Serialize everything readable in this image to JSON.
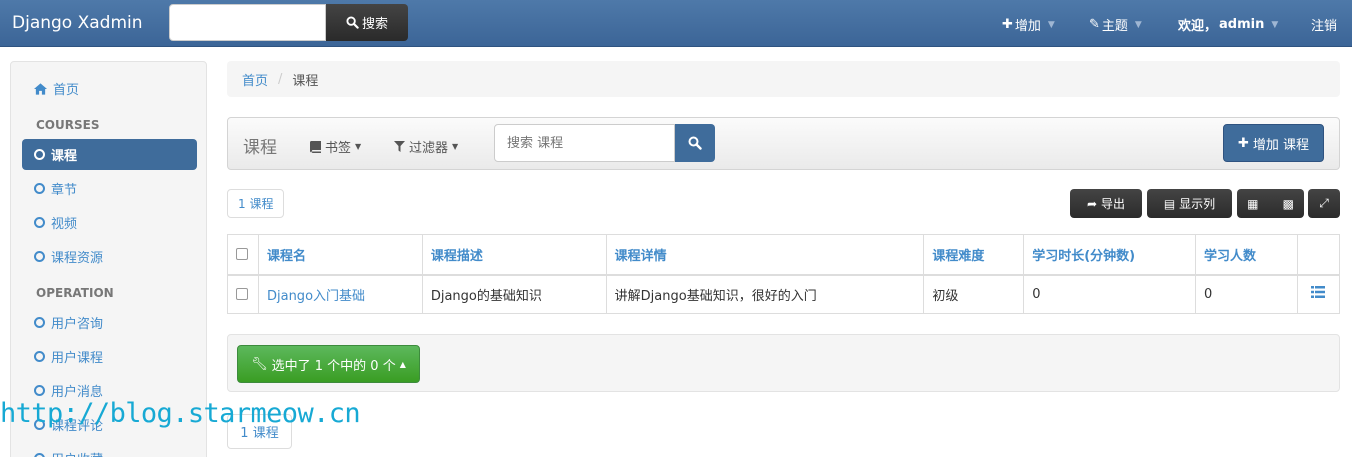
{
  "navbar": {
    "brand": "Django Xadmin",
    "search_button": "搜索",
    "add": "增加",
    "theme": "主题",
    "welcome": "欢迎，",
    "username": "admin",
    "logout": "注销"
  },
  "sidebar": {
    "home": "首页",
    "sections": [
      {
        "title": "COURSES",
        "items": [
          "课程",
          "章节",
          "视频",
          "课程资源"
        ]
      },
      {
        "title": "OPERATION",
        "items": [
          "用户咨询",
          "用户课程",
          "用户消息",
          "课程评论",
          "用户收藏"
        ]
      }
    ],
    "active_item": "课程"
  },
  "breadcrumb": {
    "home": "首页",
    "current": "课程"
  },
  "toolbar": {
    "title": "课程",
    "bookmarks": "书签",
    "filters": "过滤器",
    "search_placeholder": "搜索 课程",
    "add_button": "增加 课程"
  },
  "list": {
    "count": "1 课程",
    "export": "导出",
    "display_columns": "显示列",
    "columns": [
      "课程名",
      "课程描述",
      "课程详情",
      "课程难度",
      "学习时长(分钟数)",
      "学习人数"
    ],
    "rows": [
      {
        "name": "Django入门基础",
        "desc": "Django的基础知识",
        "detail": "讲解Django基础知识，很好的入门",
        "degree": "初级",
        "learn_times": "0",
        "students": "0"
      }
    ]
  },
  "actions": {
    "selected": "选中了 1 个中的 0 个"
  },
  "footer": {
    "count": "1 课程"
  },
  "watermark": "http://blog.starmeow.cn",
  "colors": {
    "navbar": "#3f6c9b",
    "link": "#428bca",
    "action_green": "#4cae4c",
    "watermark": "#17a9d4"
  }
}
